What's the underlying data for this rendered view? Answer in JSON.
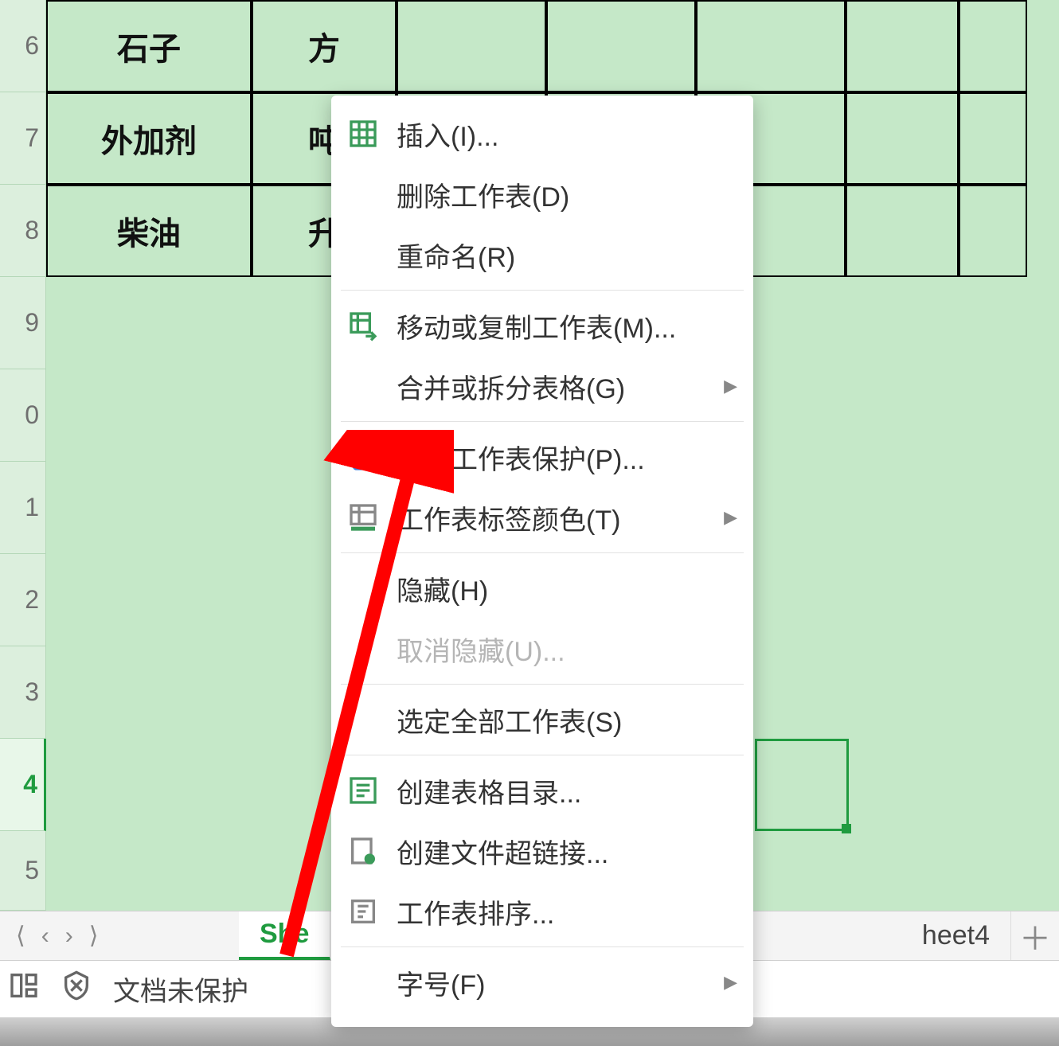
{
  "rows": {
    "r6": "6",
    "r7": "7",
    "r8": "8",
    "r9": "9",
    "r10": "0",
    "r11": "1",
    "r12": "2",
    "r13": "3",
    "r14": "4",
    "r15": "5"
  },
  "cells": {
    "a6": "石子",
    "b6": "方",
    "a7": "外加剂",
    "b7": "吨",
    "a8": "柴油",
    "b8": "升"
  },
  "tabs": {
    "active": "She",
    "other": "heet4"
  },
  "status": {
    "text": "文档未保护"
  },
  "menu": {
    "insert": "插入(I)...",
    "delete": "删除工作表(D)",
    "rename": "重命名(R)",
    "move": "移动或复制工作表(M)...",
    "merge": "合并或拆分表格(G)",
    "unprotect": "撤消工作表保护(P)...",
    "tabcolor": "工作表标签颜色(T)",
    "hide": "隐藏(H)",
    "unhide": "取消隐藏(U)...",
    "selectall": "选定全部工作表(S)",
    "toc": "创建表格目录...",
    "hyperlink": "创建文件超链接...",
    "sort": "工作表排序...",
    "fontsize": "字号(F)"
  }
}
